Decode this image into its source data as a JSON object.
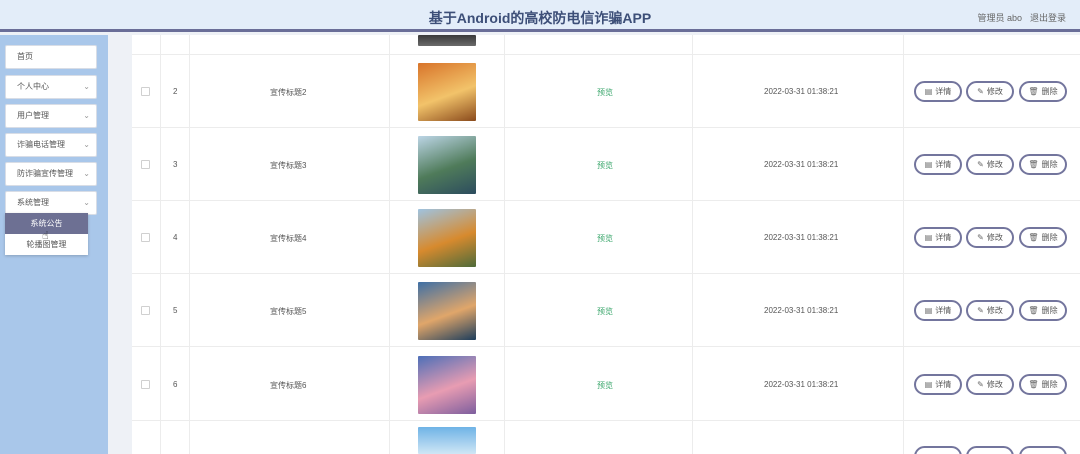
{
  "header": {
    "title": "基于Android的高校防电信诈骗APP",
    "admin": "管理员 abo",
    "logout": "退出登录"
  },
  "sidebar": {
    "items": [
      {
        "label": "首页"
      },
      {
        "label": "个人中心"
      },
      {
        "label": "用户管理"
      },
      {
        "label": "诈骗电话管理"
      },
      {
        "label": "防诈骗宣传管理"
      },
      {
        "label": "系统管理"
      }
    ],
    "submenu": [
      {
        "label": "系统公告",
        "active": true
      },
      {
        "label": "轮播图管理",
        "active": false
      }
    ]
  },
  "table": {
    "rows": [
      {
        "index": "2",
        "title": "宣传标题2",
        "preview": "预览",
        "time": "2022-03-31 01:38:21",
        "colors": [
          "#d8742a",
          "#f2c36a",
          "#8a4a1c"
        ]
      },
      {
        "index": "3",
        "title": "宣传标题3",
        "preview": "预览",
        "time": "2022-03-31 01:38:21",
        "colors": [
          "#bcd5e6",
          "#4f7b5a",
          "#2c4c5e"
        ]
      },
      {
        "index": "4",
        "title": "宣传标题4",
        "preview": "预览",
        "time": "2022-03-31 01:38:21",
        "colors": [
          "#9fc3e0",
          "#d78a2e",
          "#4e6b3a"
        ]
      },
      {
        "index": "5",
        "title": "宣传标题5",
        "preview": "预览",
        "time": "2022-03-31 01:38:21",
        "colors": [
          "#3e6fa5",
          "#e0a66a",
          "#1c3d5c"
        ]
      },
      {
        "index": "6",
        "title": "宣传标题6",
        "preview": "预览",
        "time": "2022-03-31 01:38:21",
        "colors": [
          "#4d6fb8",
          "#e89cb2",
          "#7d5e9e"
        ]
      }
    ],
    "actions": {
      "detail": "详情",
      "edit": "修改",
      "delete": "删除"
    }
  }
}
